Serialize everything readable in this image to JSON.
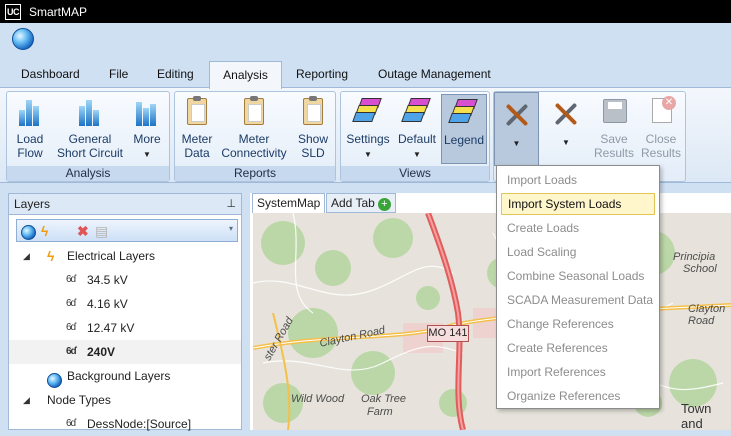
{
  "window": {
    "logo": "UC",
    "title": "SmartMAP"
  },
  "icons": {
    "app": "globe-icon"
  },
  "tabs": [
    {
      "label": "Dashboard"
    },
    {
      "label": "File"
    },
    {
      "label": "Editing"
    },
    {
      "label": "Analysis",
      "active": true
    },
    {
      "label": "Reporting"
    },
    {
      "label": "Outage Management"
    }
  ],
  "ribbon": {
    "analysis": {
      "group_label": "Analysis",
      "load_flow": "Load\nFlow",
      "load_flow_l1": "Load",
      "load_flow_l2": "Flow",
      "gsc_l1": "General",
      "gsc_l2": "Short Circuit",
      "more": "More"
    },
    "reports": {
      "group_label": "Reports",
      "meter_data_l1": "Meter",
      "meter_data_l2": "Data",
      "meter_conn_l1": "Meter",
      "meter_conn_l2": "Connectivity",
      "show_sld_l1": "Show",
      "show_sld_l2": "SLD"
    },
    "views": {
      "group_label": "Views",
      "settings": "Settings",
      "default": "Default",
      "legend": "Legend"
    },
    "tools": {
      "save_l1": "Save",
      "save_l2": "Results",
      "close_l1": "Close",
      "close_l2": "Results"
    }
  },
  "layers_panel": {
    "title": "Layers",
    "pin": "↓",
    "items": [
      {
        "label": "Electrical Layers"
      },
      {
        "label": "34.5 kV"
      },
      {
        "label": "4.16 kV"
      },
      {
        "label": "12.47 kV"
      },
      {
        "label": "240V",
        "selected": true
      },
      {
        "label": "Background Layers"
      },
      {
        "label": "Node Types"
      },
      {
        "label": "DessNode:[Source]"
      }
    ]
  },
  "doc_tabs": {
    "active": "SystemMap",
    "add": "Add Tab"
  },
  "map": {
    "labels": {
      "route": "MO 141",
      "clayton_road_1": "Clayton Road",
      "clayton_road_2": "Clayton Road",
      "wild_wood": "Wild Wood",
      "oak_tree": "Oak Tree",
      "farm": "Farm",
      "principia": "Principia",
      "school": "School",
      "town_and": "Town and",
      "ster_road": "ster Road"
    }
  },
  "dropdown": {
    "items": [
      {
        "label": "Import Loads",
        "enabled": false
      },
      {
        "label": "Import System Loads",
        "enabled": true,
        "highlighted": true
      },
      {
        "label": "Create Loads",
        "enabled": false
      },
      {
        "label": "Load Scaling",
        "enabled": false
      },
      {
        "label": "Combine Seasonal Loads",
        "enabled": false
      },
      {
        "label": "SCADA Measurement Data",
        "enabled": false
      },
      {
        "label": "Change References",
        "enabled": false
      },
      {
        "label": "Create References",
        "enabled": false
      },
      {
        "label": "Import References",
        "enabled": false
      },
      {
        "label": "Organize References",
        "enabled": false
      }
    ]
  },
  "colors": {
    "ribbon_bg": "#cfe0f3",
    "highlight": "#fff6cc",
    "route_red": "#e05d5d",
    "map_green": "#b7d6a2"
  }
}
